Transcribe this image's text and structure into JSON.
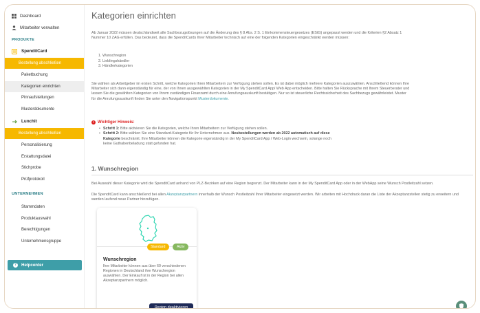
{
  "sidebar": {
    "dashboard": "Dashboard",
    "employees": "Mitarbeiter verwalten",
    "section_products": "PRODUKTE",
    "brand_spendit": "SpenditCard",
    "spendit_button": "Bestellung abschließen",
    "spendit_items": [
      "Paketbuchung",
      "Kategorien einrichten",
      "Pinnaufstellungen",
      "Musterdokumente"
    ],
    "brand_lunchit": "Lunchit",
    "lunchit_button": "Bestellung abschließen",
    "lunchit_items": [
      "Personalisierung",
      "Erstattungsdatei",
      "Stichprobe",
      "Prüfprotokoll"
    ],
    "section_company": "UNTERNEHMEN",
    "company_items": [
      "Stammdaten",
      "Produktauswahl",
      "Berechtigungen",
      "Unternehmensgruppe"
    ],
    "help": "Helpcenter"
  },
  "main": {
    "title": "Kategorien einrichten",
    "intro": "Ab Januar 2022 müssen deutschlandweit alle Sachbezugslösungen auf die Änderung des § 8 Abs. 2 S. 1 Einkommensteuergesetzes (EStG) angepasst werden und die Kriterien §2 Absatz 1 Nummer 10 ZAG erfüllen. Das bedeutet, dass die SpenditCards Ihrer Mitarbeiter technisch auf eine der folgenden Kategorien eingeschränkt werden müssen:",
    "categories": [
      "1. Wunschregion",
      "2. Lieblingshändler",
      "3. Händlerkategorien"
    ],
    "para2": "Sie wählen als Arbeitgeber im ersten Schritt, welche Kategorien Ihren Mitarbeitern zur Verfügung stehen sollen. Es ist dabei möglich mehrere Kategorien auszuwählen. Anschließend können Ihre Mitarbeiter sich dann eigenständig für eine, der von Ihnen ausgewählten Kategorien in der My SpenditCard App/ Web App entscheiden. Bitte halten Sie Rücksprache mit Ihrem Steuerberater und lassen Sie die gewählten Kategorien von Ihrem zuständigen Finanzamt durch eine Anrufungsauskunft bestätigen. Nur so ist steuerliche Rechtssicherheit des Sachbezugs gewährleistet. Muster für die Anrufungsauskunft finden Sie unter den Navigationspunkt",
    "para2_link": "Musterdokumente.",
    "hint_title": "Wichtiger Hinweis:",
    "step1_label": "Schritt 1:",
    "step1_text": "Bitte aktivieren Sie die Kategorien, welche Ihren Mitarbeitern zur Verfügung stehen sollen.",
    "step2_label": "Schritt 2:",
    "step2_text_a": "Bitte wählen Sie eine Standard-Kategorie für Ihr Unternehmen aus.",
    "step2_bold": "Neubestellungen werden ab 2022 automatisch auf diese Kategorie",
    "step2_text_b": "beschränkt. Ihre Mitarbeiter können die Kategorie eigenständig in der My SpenditCard App / Web-Login wechseln, solange noch keine Guthabenbeladung statt gefunden hat.",
    "section1_title": "1. Wunschregion",
    "region_p1": "Bei Auswahl dieser Kategorie wird die SpenditCard anhand von PLZ-Bezirken auf eine Region begrenzt. Der Mitarbeiter kann in der My SpenditCard App oder in der WebApp seine Wunsch Postleitzahl setzen.",
    "region_p2_a": "Die SpenditCard kann anschließend bei allen",
    "region_p2_link": "Akzeptanzpartnern",
    "region_p2_b": "innerhalb der Wunsch Postleitzahl Ihrer Mitarbeiter eingesetzt werden. Wir arbeiten mit Hochdruck daran die Liste der Akzeptanzstellen stetig zu erweitern und werden laufend neue Partner hinzufügen."
  },
  "card": {
    "badge_standard": "Standard",
    "badge_active": "Aktiv",
    "title": "Wunschregion",
    "text": "Ihre Mitarbeiter können aus über 60 verschiedenen Regionen in Deutschland ihre Wunschregion auswählen. Der Einkauf ist in der Region bei allen Akzeptanzpartnern möglich.",
    "button": "Region deaktivieren"
  },
  "colors": {
    "accent_yellow": "#f6b800",
    "teal": "#3e9ea8",
    "active_green": "#86b85f",
    "button_navy": "#1e2a57"
  }
}
